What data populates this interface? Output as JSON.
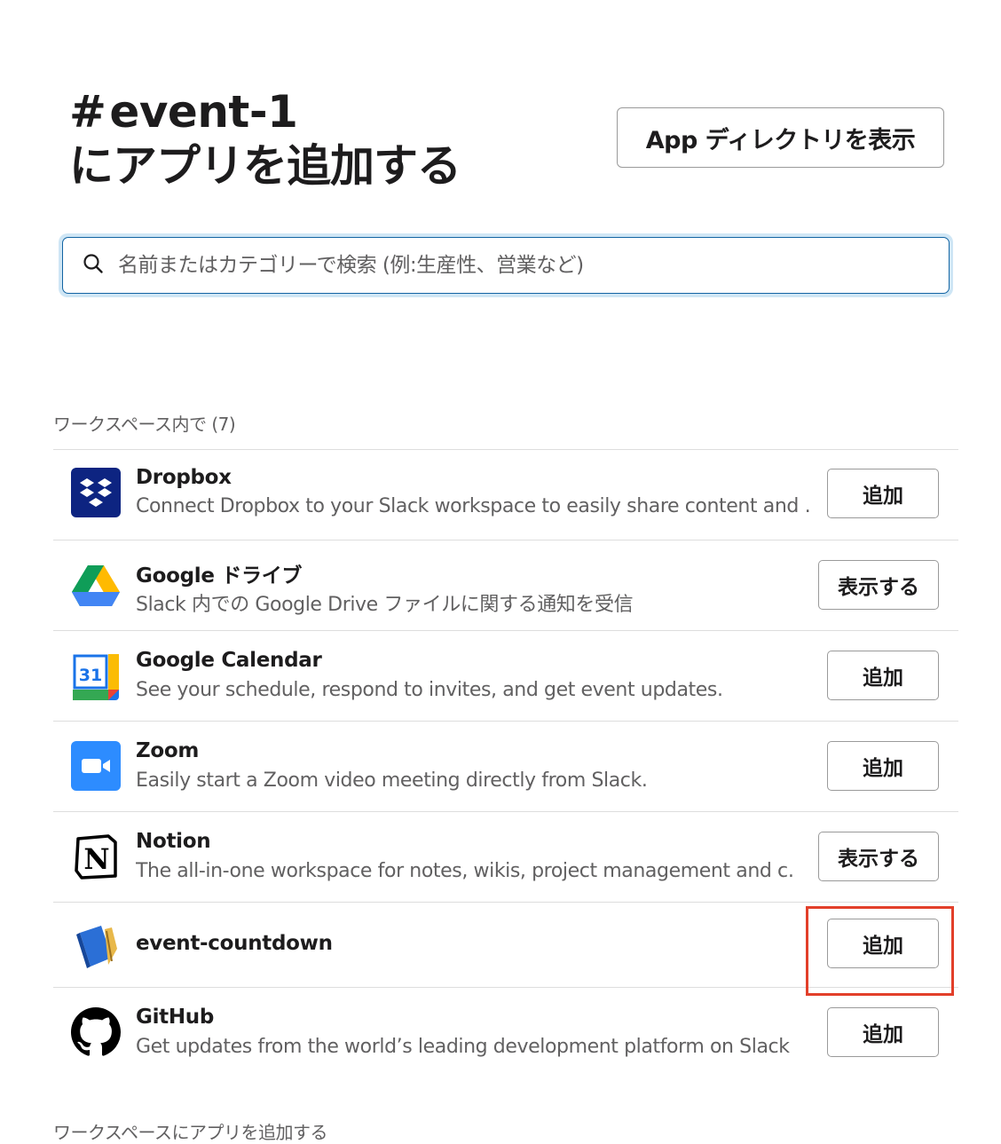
{
  "header": {
    "channel_hash": "#",
    "channel_name": "event-1",
    "subtitle": "にアプリを追加する",
    "directory_button": "App ディレクトリを表示"
  },
  "search": {
    "placeholder": "名前またはカテゴリーで検索 (例:生産性、営業など)"
  },
  "section_label": "ワークスペース内で (7)",
  "apps": [
    {
      "name": "Dropbox",
      "desc": "Connect Dropbox to your Slack workspace to easily share content and …",
      "button": "追加",
      "icon": "dropbox-icon"
    },
    {
      "name": "Google ドライブ",
      "desc": "Slack 内での Google Drive ファイルに関する通知を受信",
      "button": "表示する",
      "icon": "google-drive-icon"
    },
    {
      "name": "Google Calendar",
      "desc": "See your schedule, respond to invites, and get event updates.",
      "button": "追加",
      "icon": "google-calendar-icon",
      "icon_text": "31"
    },
    {
      "name": "Zoom",
      "desc": "Easily start a Zoom video meeting directly from Slack.",
      "button": "追加",
      "icon": "zoom-icon"
    },
    {
      "name": "Notion",
      "desc": "The all-in-one workspace for notes, wikis, project management and c…",
      "button": "表示する",
      "icon": "notion-icon",
      "icon_text": "N"
    },
    {
      "name": "event-countdown",
      "desc": "",
      "button": "追加",
      "icon": "notebook-icon"
    },
    {
      "name": "GitHub",
      "desc": "Get updates from the world’s leading development platform on Slack",
      "button": "追加",
      "icon": "github-icon"
    }
  ],
  "footer_label": "ワークスペースにアプリを追加する",
  "colors": {
    "highlight": "#e23f2a",
    "search_focus": "#1264a3",
    "dropbox": "#0d2481",
    "zoom": "#2d8cff"
  }
}
